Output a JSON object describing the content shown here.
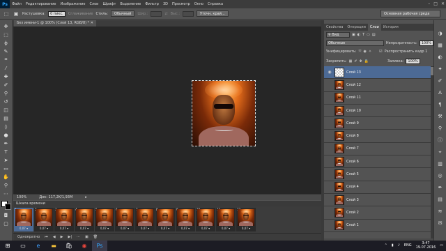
{
  "menubar": {
    "logo": "Ps",
    "items": [
      "Файл",
      "Редактирование",
      "Изображение",
      "Слои",
      "Шрифт",
      "Выделение",
      "Фильтр",
      "3D",
      "Просмотр",
      "Окно",
      "Справка"
    ],
    "window_controls": [
      "–",
      "□",
      "✕"
    ]
  },
  "options": {
    "feather_label": "Растушевка:",
    "feather_value": "0 пикс.",
    "antialias_label": "Сглаживание",
    "style_label": "Стиль:",
    "style_value": "Обычный",
    "width_label": "Шир.:",
    "height_label": "Выс.:",
    "refine_edge": "Уточн. край...",
    "workspace": "Основная рабочая среда"
  },
  "document": {
    "tab_title": "Без имени-1 @ 100% (Слой 13, RGB/8) *",
    "zoom": "100%",
    "doc_size": "Док: 117,2K/1,93M"
  },
  "timeline": {
    "tab_label": "Шкала времени",
    "frames": [
      {
        "num": "1",
        "delay": "0,07"
      },
      {
        "num": "2",
        "delay": "0,07"
      },
      {
        "num": "3",
        "delay": "0,07"
      },
      {
        "num": "4",
        "delay": "0,07"
      },
      {
        "num": "5",
        "delay": "0,07"
      },
      {
        "num": "6",
        "delay": "0,07"
      },
      {
        "num": "7",
        "delay": "0,07"
      },
      {
        "num": "8",
        "delay": "0,07"
      },
      {
        "num": "9",
        "delay": "0,07"
      },
      {
        "num": "10",
        "delay": "0,07"
      },
      {
        "num": "11",
        "delay": "0,07"
      },
      {
        "num": "12",
        "delay": "0,07"
      }
    ],
    "loop_label": "Однократно"
  },
  "panels": {
    "tabs": [
      "Свойства",
      "Операции",
      "Слои",
      "История"
    ],
    "kind_label": "Вид",
    "blend_mode": "Обычные",
    "opacity_label": "Непрозрачность:",
    "opacity_value": "100%",
    "unify_label": "Унифицировать:",
    "propagate_label": "Распространить кадр 1",
    "lock_label": "Закрепить:",
    "fill_label": "Заливка:",
    "fill_value": "100%"
  },
  "layers": [
    {
      "name": "Слой 13",
      "selected": true,
      "transparent": true
    },
    {
      "name": "Слой 12"
    },
    {
      "name": "Слой 11"
    },
    {
      "name": "Слой 10"
    },
    {
      "name": "Слой 9"
    },
    {
      "name": "Слой 8"
    },
    {
      "name": "Слой 7"
    },
    {
      "name": "Слой 6"
    },
    {
      "name": "Слой 5"
    },
    {
      "name": "Слой 4"
    },
    {
      "name": "Слой 3"
    },
    {
      "name": "Слой 2"
    },
    {
      "name": "Слой 1"
    }
  ],
  "taskbar": {
    "lang": "ENG",
    "time": "3:47",
    "date": "19.07.2016"
  },
  "colors": {
    "selection_blue": "#4c6a95",
    "app_bg": "#535353",
    "canvas_bg": "#262626"
  }
}
